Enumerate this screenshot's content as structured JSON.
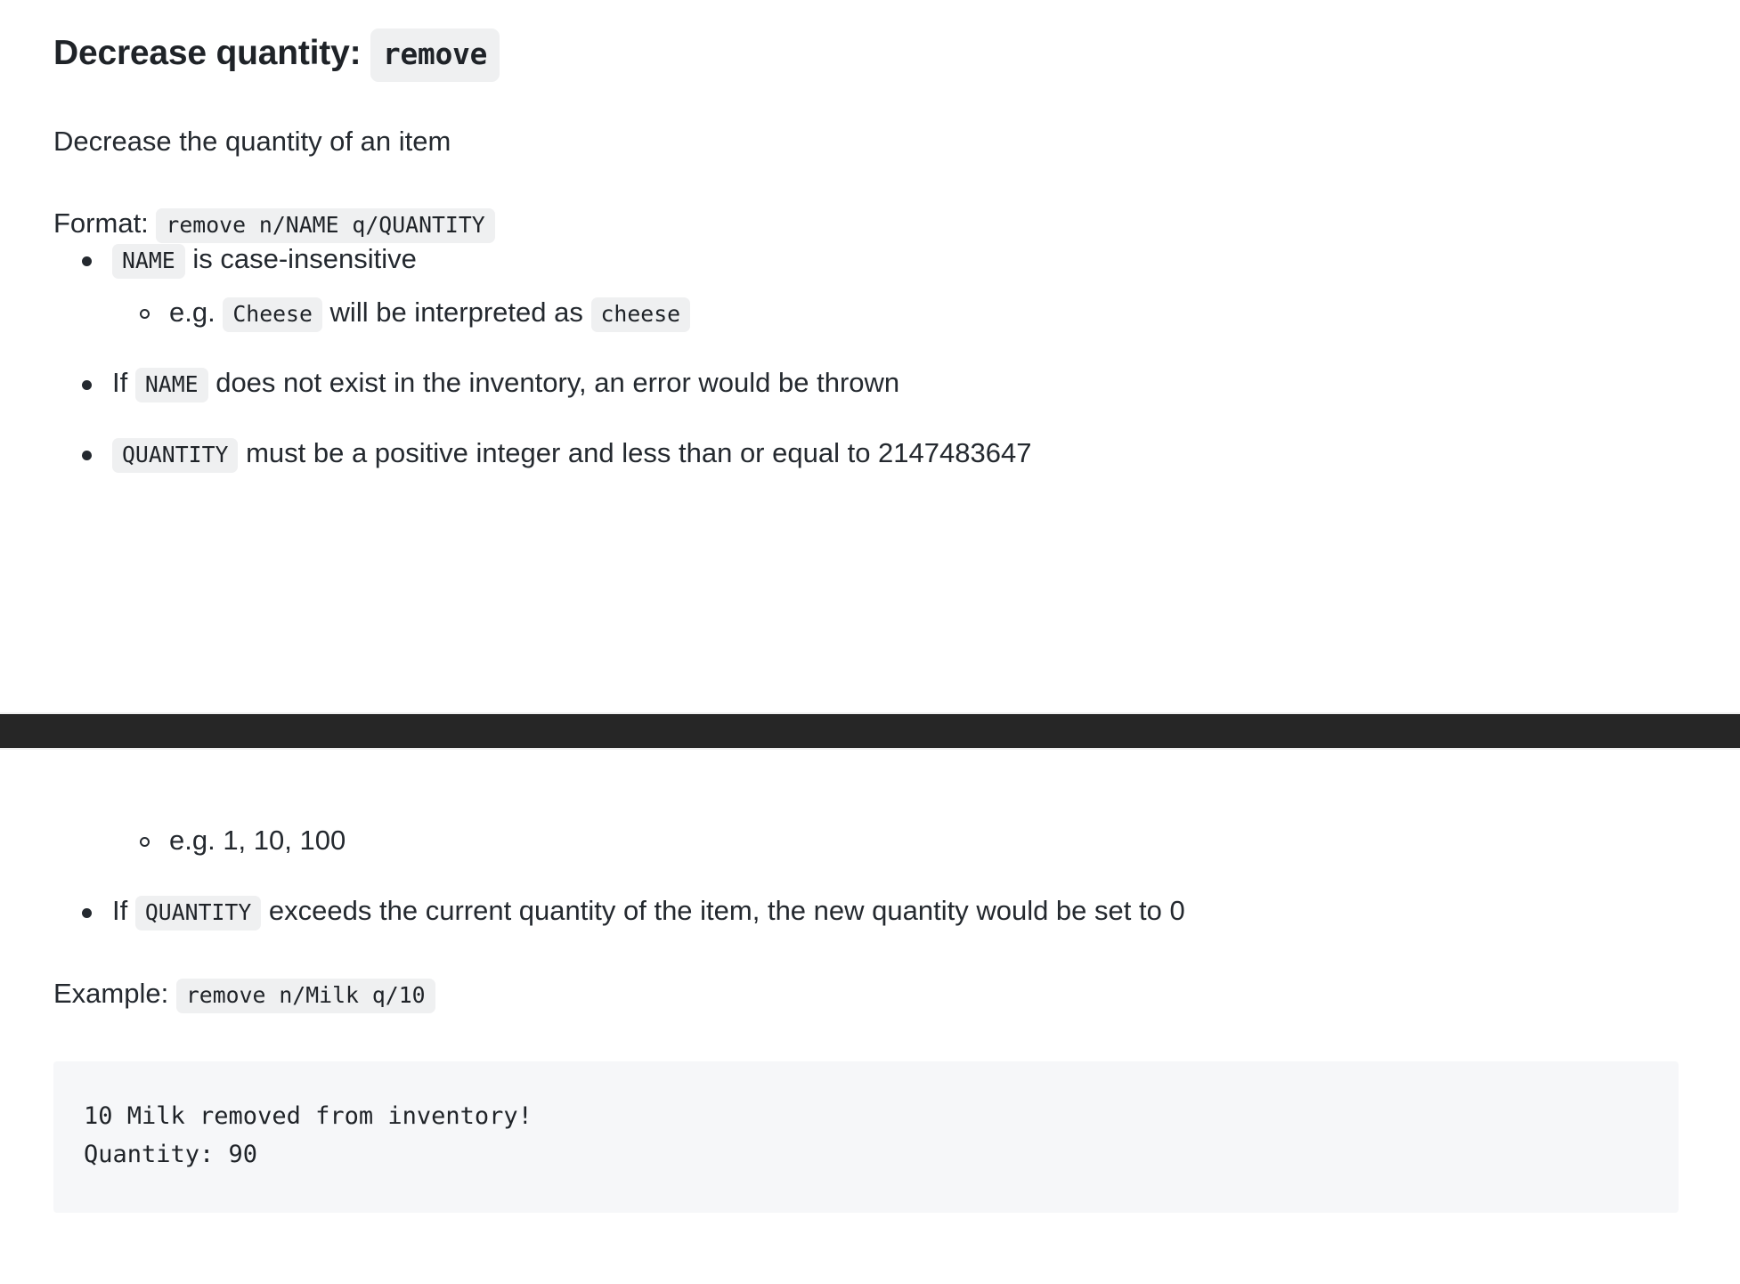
{
  "document": {
    "kind": "user-guide-command-reference",
    "theme": {
      "page_background": "#ffffff",
      "text_color": "#24292f",
      "inline_code_background": "#eff0f1",
      "code_block_background": "#f6f7f9",
      "page_break_band": "#262626"
    }
  },
  "top_fragment": {
    "heading": {
      "label": "Decrease quantity:",
      "command": "remove"
    },
    "description": "Decrease the quantity of an item",
    "format": {
      "label": "Format:",
      "value": "remove n/NAME q/QUANTITY"
    },
    "bullets": [
      {
        "code_lead": "NAME",
        "text": "is case-insensitive",
        "sub": [
          {
            "prefix": "e.g.",
            "code_a": "Cheese",
            "middle": "will be interpreted as",
            "code_b": "cheese"
          }
        ]
      },
      {
        "prefix": "If",
        "code_lead": "NAME",
        "text": "does not exist in the inventory, an error would be thrown"
      },
      {
        "code_lead": "QUANTITY",
        "text": "must be a positive integer and less than or equal to 2147483647"
      }
    ]
  },
  "bottom_fragment": {
    "sub_bullet": "e.g. 1, 10, 100",
    "bullet": {
      "prefix": "If",
      "code_lead": "QUANTITY",
      "text": "exceeds the current quantity of the item, the new quantity would be set to 0"
    },
    "example": {
      "label": "Example:",
      "value": "remove n/Milk q/10"
    },
    "output_block": {
      "line1": "10 Milk removed from inventory!",
      "line2": "Quantity: 90"
    }
  }
}
